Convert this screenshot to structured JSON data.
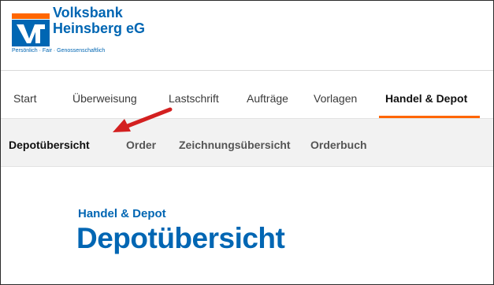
{
  "bank": {
    "name_line1": "Volksbank",
    "name_line2": "Heinsberg eG",
    "tagline": "Persönlich · Fair · Genossenschaftlich",
    "logo_icon": "vr-bank-logo-icon"
  },
  "main_nav": {
    "items": [
      {
        "label": "Start"
      },
      {
        "label": "Überweisung"
      },
      {
        "label": "Lastschrift"
      },
      {
        "label": "Aufträge"
      },
      {
        "label": "Vorlagen"
      },
      {
        "label": "Handel & Depot"
      }
    ],
    "active": "Handel & Depot"
  },
  "sub_nav": {
    "items": [
      {
        "label": "Depotübersicht"
      },
      {
        "label": "Order"
      },
      {
        "label": "Zeichnungsübersicht"
      },
      {
        "label": "Orderbuch"
      }
    ],
    "active": "Depotübersicht"
  },
  "page": {
    "eyebrow": "Handel & Depot",
    "title": "Depotübersicht"
  },
  "annotation": {
    "type": "red-arrow",
    "points_to": "Depotübersicht"
  },
  "colors": {
    "brand_blue": "#0066b3",
    "brand_orange": "#ff6600",
    "annotation_red": "#d32020"
  }
}
